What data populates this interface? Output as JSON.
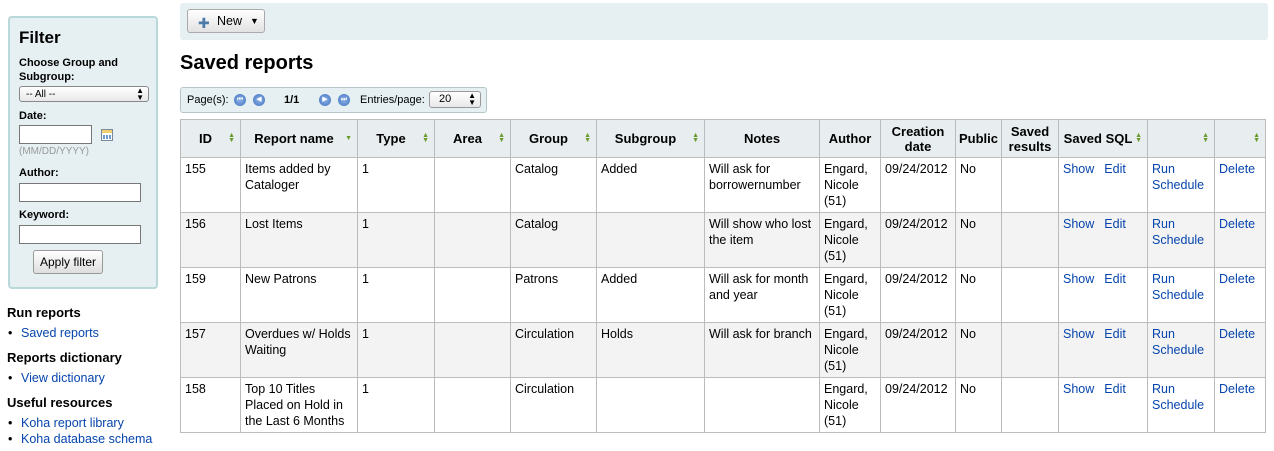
{
  "filter": {
    "title": "Filter",
    "group_label": "Choose Group and Subgroup:",
    "group_value": "-- All --",
    "date_label": "Date:",
    "date_hint": "(MM/DD/YYYY)",
    "author_label": "Author:",
    "keyword_label": "Keyword:",
    "apply_label": "Apply filter"
  },
  "nav": {
    "run_reports": "Run reports",
    "saved_reports": "Saved reports",
    "dictionary_title": "Reports dictionary",
    "view_dictionary": "View dictionary",
    "resources_title": "Useful resources",
    "report_library": "Koha report library",
    "db_schema": "Koha database schema"
  },
  "toolbar": {
    "new_label": "New"
  },
  "page_title": "Saved reports",
  "pager": {
    "pages_label": "Page(s):",
    "page_num": "1/1",
    "entries_label": "Entries/page:",
    "entries_value": "20"
  },
  "table": {
    "headers": [
      "ID",
      "Report name",
      "Type",
      "Area",
      "Group",
      "Subgroup",
      "Notes",
      "Author",
      "Creation date",
      "Public",
      "Saved results",
      "Saved SQL",
      "",
      ""
    ],
    "action_labels": {
      "show": "Show",
      "edit": "Edit",
      "run": "Run",
      "schedule": "Schedule",
      "delete": "Delete"
    },
    "rows": [
      {
        "id": "155",
        "name": "Items added by Cataloger",
        "type": "1",
        "area": "",
        "group": "Catalog",
        "subgroup": "Added",
        "notes": "Will ask for borrowernumber",
        "author": "Engard, Nicole (51)",
        "date": "09/24/2012",
        "public": "No",
        "saved_results": ""
      },
      {
        "id": "156",
        "name": "Lost Items",
        "type": "1",
        "area": "",
        "group": "Catalog",
        "subgroup": "",
        "notes": "Will show who lost the item",
        "author": "Engard, Nicole (51)",
        "date": "09/24/2012",
        "public": "No",
        "saved_results": ""
      },
      {
        "id": "159",
        "name": "New Patrons",
        "type": "1",
        "area": "",
        "group": "Patrons",
        "subgroup": "Added",
        "notes": "Will ask for month and year",
        "author": "Engard, Nicole (51)",
        "date": "09/24/2012",
        "public": "No",
        "saved_results": ""
      },
      {
        "id": "157",
        "name": "Overdues w/ Holds Waiting",
        "type": "1",
        "area": "",
        "group": "Circulation",
        "subgroup": "Holds",
        "notes": "Will ask for branch",
        "author": "Engard, Nicole (51)",
        "date": "09/24/2012",
        "public": "No",
        "saved_results": ""
      },
      {
        "id": "158",
        "name": "Top 10 Titles Placed on Hold in the Last 6 Months",
        "type": "1",
        "area": "",
        "group": "Circulation",
        "subgroup": "",
        "notes": "",
        "author": "Engard, Nicole (51)",
        "date": "09/24/2012",
        "public": "No",
        "saved_results": ""
      }
    ]
  }
}
